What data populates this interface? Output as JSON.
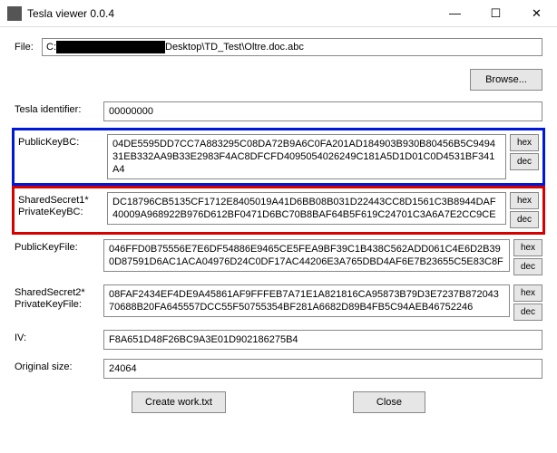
{
  "window": {
    "title": "Tesla viewer 0.0.4"
  },
  "file": {
    "label": "File:",
    "prefix": "C:",
    "suffix": "Desktop\\TD_Test\\Oltre.doc.abc",
    "browse": "Browse..."
  },
  "rows": {
    "tesla_id": {
      "label": "Tesla identifier:",
      "value": "00000000"
    },
    "publickey_bc": {
      "label": "PublicKeyBC:",
      "value": "04DE5595DD7CC7A883295C08DA72B9A6C0FA201AD184903B930B80456B5C949431EB332AA9B33E2983F4AC8DFCFD4095054026249C181A5D1D01C0D4531BF341A4"
    },
    "ss1_priv_bc": {
      "label1": "SharedSecret1*",
      "label2": "PrivateKeyBC:",
      "value": "DC18796CB5135CF1712E8405019A41D6BB08B031D22443CC8D1561C3B8944DAF40009A968922B976D612BF0471D6BC70B8BAF64B5F619C24701C3A6A7E2CC9CE"
    },
    "publickey_file": {
      "label": "PublicKeyFile:",
      "value": "046FFD0B75556E7E6DF54886E9465CE5FEA9BF39C1B438C562ADD061C4E6D2B390D87591D6AC1ACA04976D24C0DF17AC44206E3A765DBD4AF6E7B23655C5E83C8F"
    },
    "ss2_priv_file": {
      "label1": "SharedSecret2*",
      "label2": "PrivateKeyFile:",
      "value": "08FAF2434EF4DE9A45861AF9FFFEB7A71E1A821816CA95873B79D3E7237B87204370688B20FA645557DCC55F50755354BF281A6682D89B4FB5C94AEB46752246"
    },
    "iv": {
      "label": "IV:",
      "value": "F8A651D48F26BC9A3E01D902186275B4"
    },
    "orig_size": {
      "label": "Original size:",
      "value": "24064"
    }
  },
  "buttons": {
    "hex": "hex",
    "dec": "dec",
    "create_work": "Create work.txt",
    "close": "Close"
  }
}
